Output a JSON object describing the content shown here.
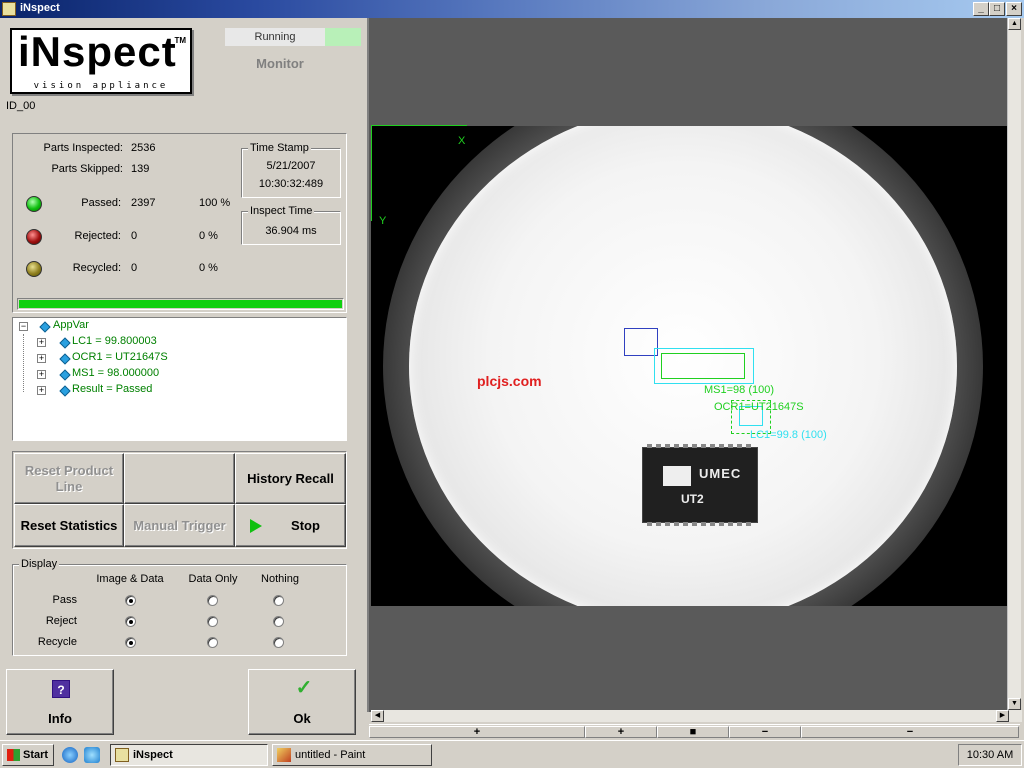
{
  "window": {
    "title": "iNspect",
    "min": "_",
    "max": "□",
    "close": "×"
  },
  "logo": {
    "text": "iNspect",
    "tm": "TM",
    "tagline": "vision appliance"
  },
  "status": {
    "state": "Running",
    "mode": "Monitor"
  },
  "id_label": "ID_00",
  "stats": {
    "parts_inspected_label": "Parts Inspected:",
    "parts_inspected": "2536",
    "parts_skipped_label": "Parts Skipped:",
    "parts_skipped": "139",
    "passed_label": "Passed:",
    "passed": "2397",
    "passed_pct": "100 %",
    "rejected_label": "Rejected:",
    "rejected": "0",
    "rejected_pct": "0 %",
    "recycled_label": "Recycled:",
    "recycled": "0",
    "recycled_pct": "0 %",
    "progress": 1.0
  },
  "timestamp": {
    "title": "Time Stamp",
    "date": "5/21/2007",
    "time": "10:30:32:489"
  },
  "inspect_time": {
    "title": "Inspect Time",
    "value": "36.904 ms"
  },
  "tree": {
    "root": "AppVar",
    "items": [
      "LC1 = 99.800003",
      "OCR1 = UT21647S",
      "MS1 = 98.000000",
      "Result = Passed"
    ]
  },
  "buttons": {
    "reset_product_line": "Reset Product Line",
    "history_recall": "History Recall",
    "reset_statistics": "Reset Statistics",
    "manual_trigger": "Manual Trigger",
    "stop": "Stop"
  },
  "display": {
    "title": "Display",
    "columns": [
      "Image & Data",
      "Data Only",
      "Nothing"
    ],
    "rows": [
      "Pass",
      "Reject",
      "Recycle"
    ]
  },
  "info_button": "Info",
  "ok_button": "Ok",
  "viewer": {
    "axis_x": "X",
    "axis_y": "Y",
    "chip_text1": "UMEC",
    "chip_text2": "UT2",
    "ms_label": "MS1=98 (100)",
    "ocr_label": "OCR1=UT21647S",
    "lc_label": "LC1=99.8 (100)",
    "watermark": "plcjs.com"
  },
  "zoombar": {
    "zoom_in_big": "+",
    "zoom_in": "+",
    "zoom_fit": "■",
    "zoom_out": "−",
    "zoom_out_big": "−"
  },
  "taskbar": {
    "start": "Start",
    "task_active": "iNspect",
    "task_paint": "untitled - Paint",
    "clock": "10:30 AM"
  },
  "colors": {
    "pass_green": "#10d010",
    "overlay_green": "#20d020",
    "overlay_cyan": "#30e0f0"
  }
}
